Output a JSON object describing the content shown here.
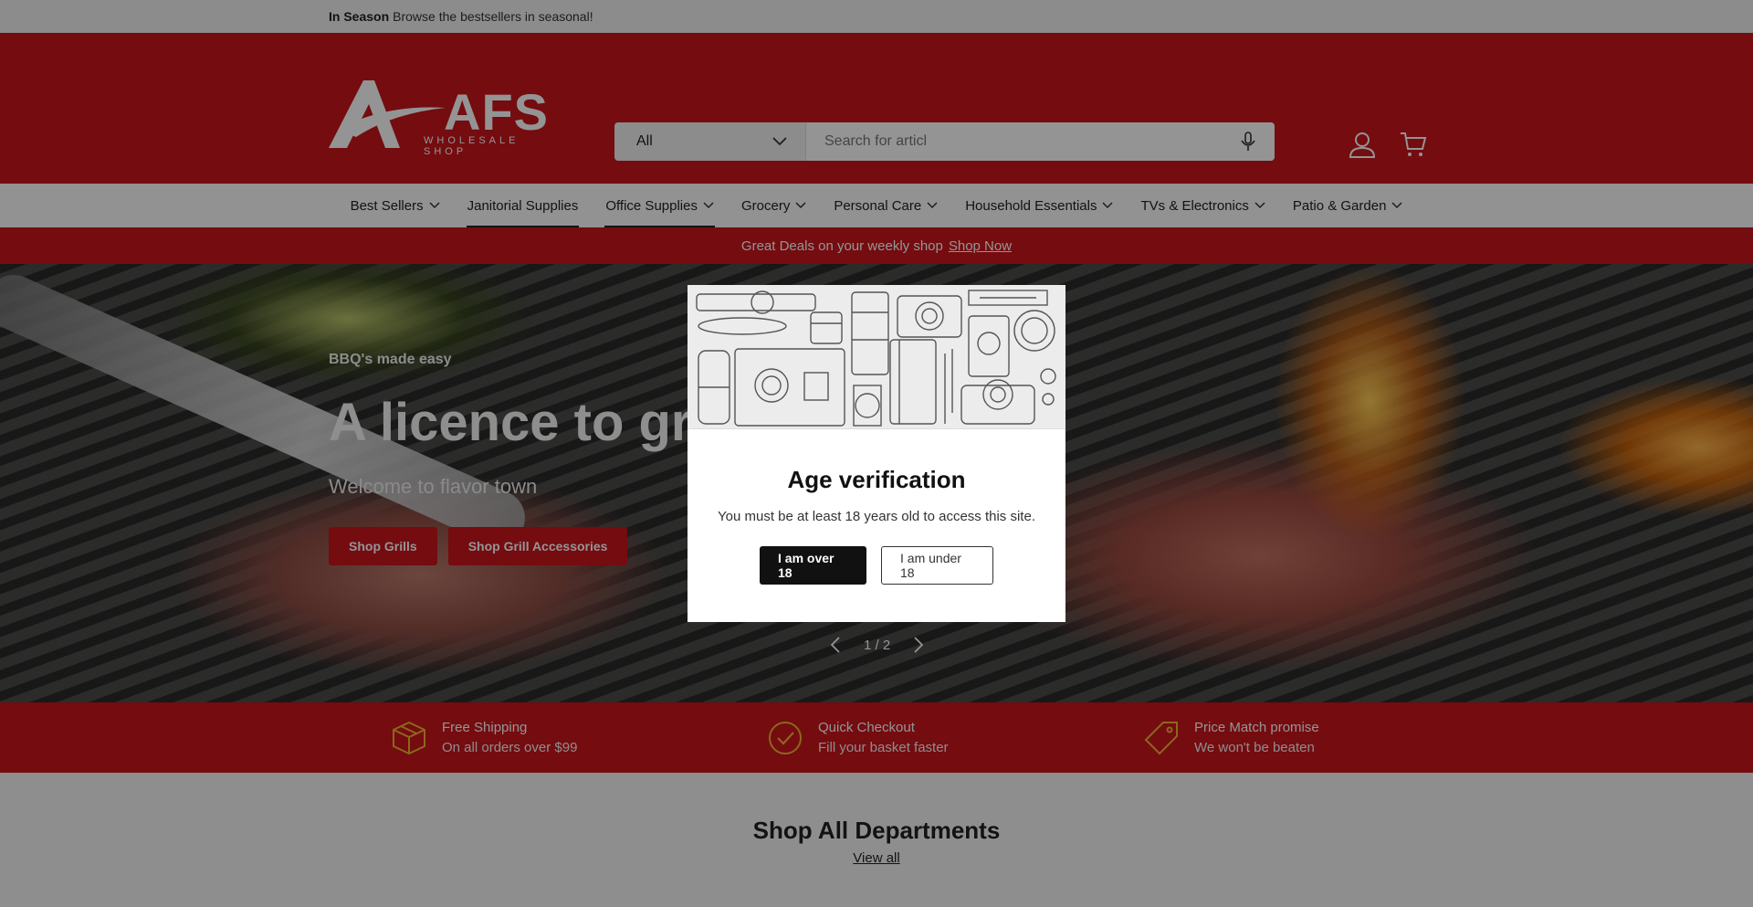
{
  "topbar": {
    "bold": "In Season",
    "text": "Browse the bestsellers in seasonal!"
  },
  "header": {
    "logo_main": "AFS",
    "logo_sub": "WHOLESALE SHOP",
    "search": {
      "category": "All",
      "placeholder": "Search for articl"
    },
    "icons": [
      "account-icon",
      "cart-icon"
    ]
  },
  "nav": {
    "items": [
      {
        "label": "Best Sellers",
        "dropdown": true
      },
      {
        "label": "Janitorial Supplies",
        "dropdown": false
      },
      {
        "label": "Office Supplies",
        "dropdown": true
      },
      {
        "label": "Grocery",
        "dropdown": true
      },
      {
        "label": "Personal Care",
        "dropdown": true
      },
      {
        "label": "Household Essentials",
        "dropdown": true
      },
      {
        "label": "TVs & Electronics",
        "dropdown": true
      },
      {
        "label": "Patio & Garden",
        "dropdown": true
      }
    ]
  },
  "promo": {
    "text": "Great Deals on your weekly shop",
    "link": "Shop Now"
  },
  "hero": {
    "eyebrow": "BBQ's made easy",
    "title": "A licence to gri",
    "tagline": "Welcome to flavor town",
    "buttons": [
      "Shop Grills",
      "Shop Grill Accessories"
    ],
    "pager": "1 / 2"
  },
  "features": [
    {
      "icon": "box-icon",
      "title": "Free Shipping",
      "subtitle": "On all orders over $99"
    },
    {
      "icon": "check-circle-icon",
      "title": "Quick Checkout",
      "subtitle": "Fill your basket faster"
    },
    {
      "icon": "price-tag-icon",
      "title": "Price Match promise",
      "subtitle": "We won't be beaten"
    }
  ],
  "departments": {
    "title": "Shop All Departments",
    "link": "View all"
  },
  "modal": {
    "title": "Age verification",
    "message": "You must be at least 18 years old to access this site.",
    "confirm": "I am over 18",
    "deny": "I am under 18"
  },
  "colors": {
    "brand_red": "#c8161d",
    "overlay": "rgba(0,0,0,0.42)"
  }
}
